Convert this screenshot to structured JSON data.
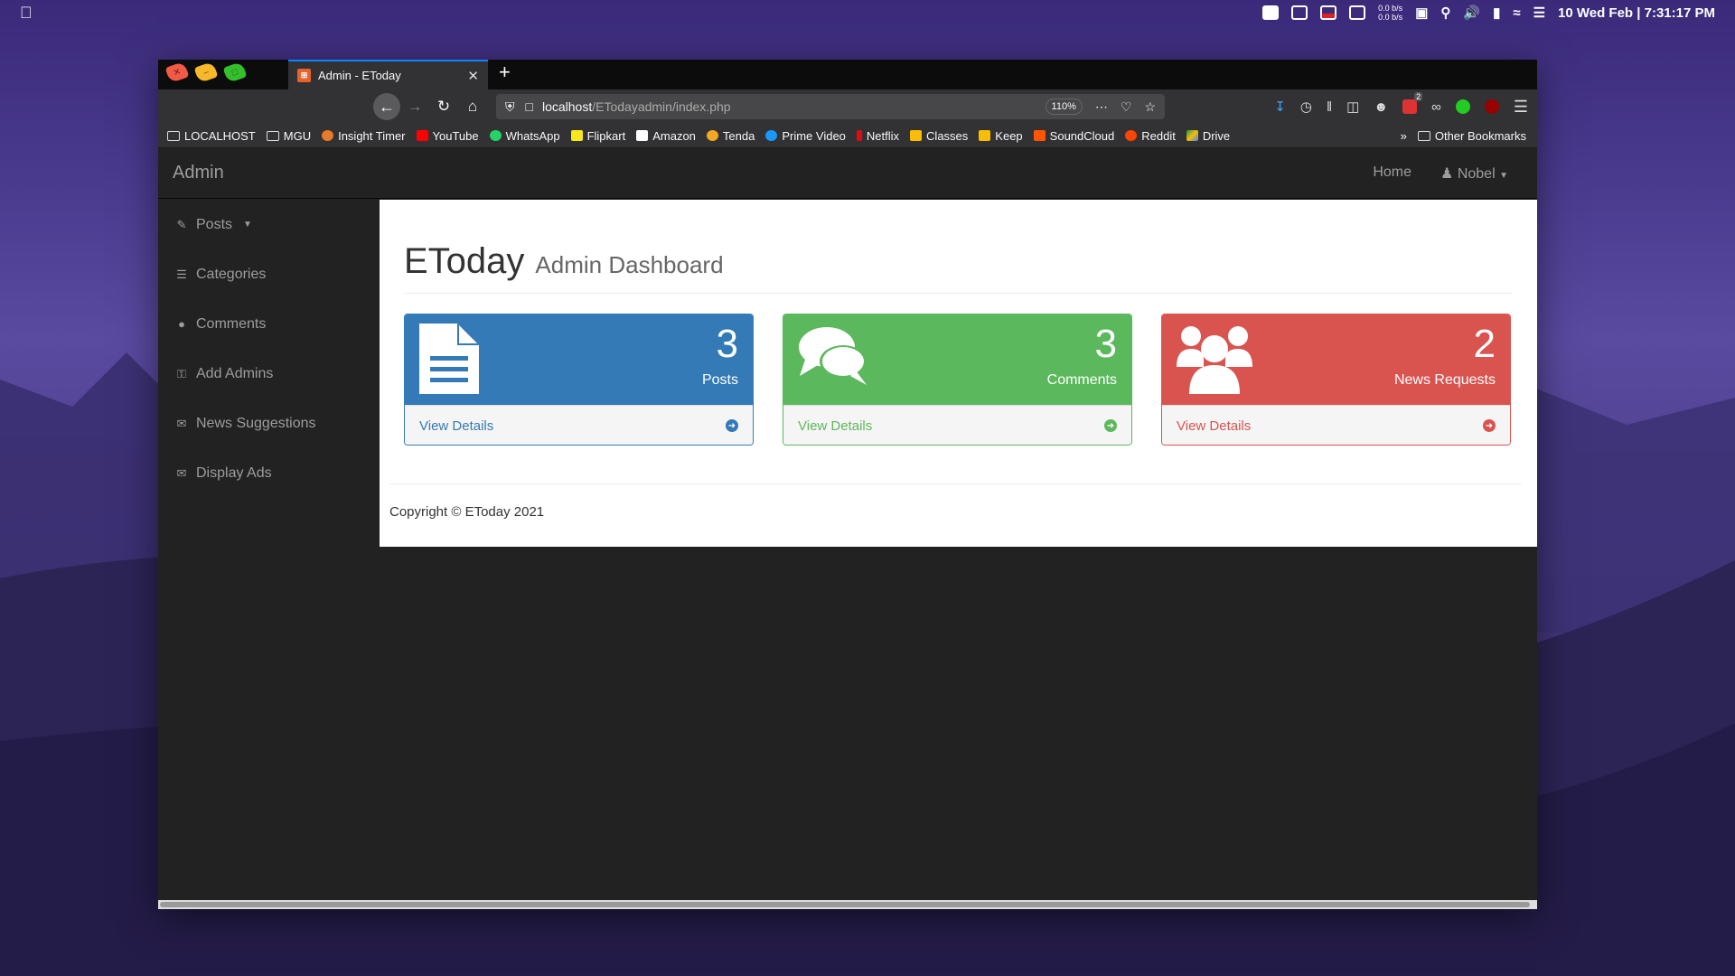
{
  "menubar": {
    "net_up": "0.0 b/s",
    "net_down": "0.0 b/s",
    "datetime": "10 Wed Feb | 7:31:17 PM"
  },
  "browser": {
    "tab_title": "Admin - EToday",
    "url_host": "localhost",
    "url_path": "/ETodayadmin/index.php",
    "zoom": "110%",
    "bookmarks": [
      "LOCALHOST",
      "MGU",
      "Insight Timer",
      "YouTube",
      "WhatsApp",
      "Flipkart",
      "Amazon",
      "Tenda",
      "Prime Video",
      "Netflix",
      "Classes",
      "Keep",
      "SoundCloud",
      "Reddit",
      "Drive"
    ],
    "other_bookmarks": "Other Bookmarks",
    "badge_count": "2"
  },
  "app": {
    "brand": "Admin",
    "nav_home": "Home",
    "nav_user": "Nobel"
  },
  "sidebar": {
    "items": [
      {
        "label": "Posts"
      },
      {
        "label": "Categories"
      },
      {
        "label": "Comments"
      },
      {
        "label": "Add Admins"
      },
      {
        "label": "News Suggestions"
      },
      {
        "label": "Display Ads"
      }
    ]
  },
  "header": {
    "title": "EToday",
    "subtitle": "Admin Dashboard"
  },
  "cards": [
    {
      "count": "3",
      "label": "Posts",
      "link": "View Details",
      "color": "#337ab7"
    },
    {
      "count": "3",
      "label": "Comments",
      "link": "View Details",
      "color": "#5cb85c"
    },
    {
      "count": "2",
      "label": "News Requests",
      "link": "View Details",
      "color": "#d9534f"
    }
  ],
  "footer": {
    "copyright": "Copyright © EToday 2021"
  }
}
